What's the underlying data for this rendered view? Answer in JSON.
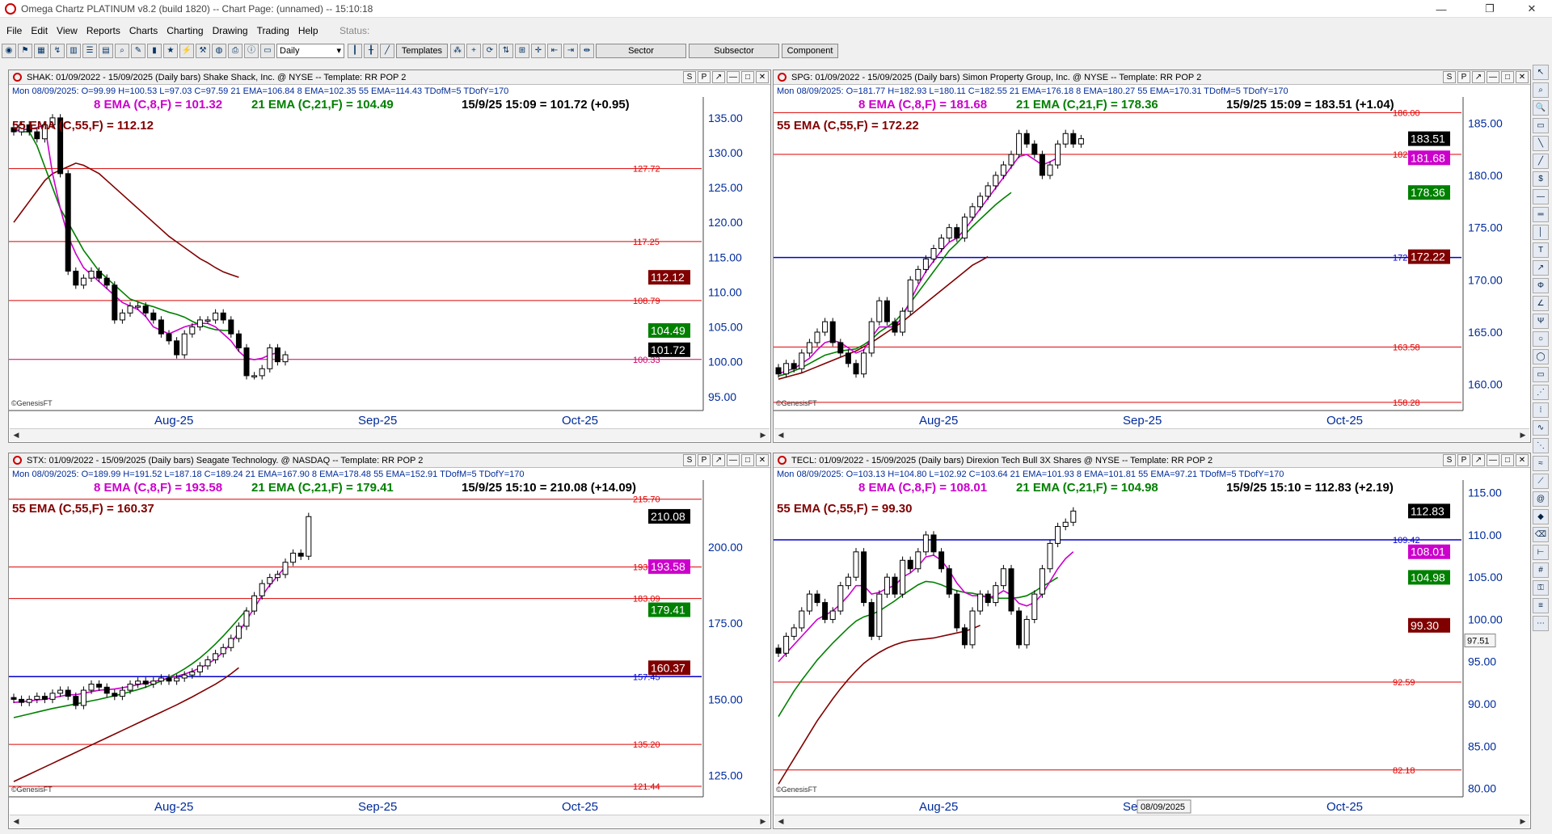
{
  "window": {
    "title": "Omega Chartz PLATINUM v8.2 (build 1820)  --  Chart Page: (unnamed)  --  15:10:18",
    "controls": [
      "—",
      "❐",
      "✕"
    ]
  },
  "menu": {
    "items": [
      "File",
      "Edit",
      "View",
      "Reports",
      "Charts",
      "Charting",
      "Drawing",
      "Trading",
      "Help"
    ],
    "status": "Status:"
  },
  "toolbar": {
    "period": "Daily",
    "templates_label": "Templates",
    "sector_label": "Sector",
    "subsector_label": "Subsector",
    "component_label": "Component"
  },
  "colors": {
    "ema8": "#cc00cc",
    "ema21": "#008000",
    "ema55": "#800000",
    "red_line": "#dd0000",
    "blue_line": "#0000cc",
    "pink_line": "#cc0066",
    "info_text": "#002b9a"
  },
  "common": {
    "watermark": "©GenesisFT",
    "months": [
      "Aug-25",
      "Sep-25",
      "Oct-25"
    ],
    "panel_buttons": [
      "S",
      "P",
      "↗",
      "—",
      "□",
      "✕"
    ]
  },
  "panels": [
    {
      "header": "SHAK:  01/09/2022 - 15/09/2025  (Daily bars)   Shake Shack, Inc. @ NYSE  --  Template: RR POP 2",
      "info": "Mon   08/09/2025:   O=99.99   H=100.53   L=97.03   C=97.59   21 EMA=106.84   8 EMA=102.35   55 EMA=114.43   TDofM=5   TDofY=170",
      "legend_ema8": "8 EMA (C,8,F) = 101.32",
      "legend_ema21": "21 EMA (C,21,F) = 104.49",
      "legend_last": "15/9/25 15:09 = 101.72 (+0.95)",
      "legend_ema55": "55 EMA (C,55,F) = 112.12",
      "ymin": 93,
      "ymax": 138,
      "yticks": [
        95,
        100,
        105,
        110,
        115,
        120,
        125,
        130,
        135
      ],
      "hlines": [
        {
          "v": 127.72,
          "label": "127.72",
          "c": "red"
        },
        {
          "v": 117.25,
          "label": "117.25",
          "c": "red"
        },
        {
          "v": 108.79,
          "label": "108.79",
          "c": "red"
        },
        {
          "v": 100.33,
          "label": "100.33",
          "c": "pink"
        }
      ],
      "tags": [
        {
          "v": 112.12,
          "label": "112.12",
          "bg": "#800000"
        },
        {
          "v": 104.49,
          "label": "104.49",
          "bg": "#008000"
        },
        {
          "v": 101.72,
          "label": "101.72",
          "bg": "#000000"
        }
      ],
      "closes": [
        133,
        134,
        133,
        132,
        134,
        135,
        127,
        113,
        111,
        112,
        113,
        112,
        111,
        106,
        107,
        108,
        108,
        107,
        106,
        104,
        103,
        101,
        104,
        105,
        106,
        106,
        107,
        106,
        104,
        102,
        98,
        98,
        99,
        102,
        100,
        101
      ],
      "ema8": [
        133,
        133.3,
        133.4,
        133.6,
        134,
        127,
        122,
        118,
        115.5,
        113.5,
        112.5,
        111.5,
        110.5,
        109.5,
        108.5,
        108,
        107.5,
        106.5,
        105,
        104.5,
        104,
        104.5,
        105,
        105.3,
        105.5,
        105.5,
        105,
        104,
        103,
        101.5,
        100.5,
        100.3,
        100.5,
        101,
        101.3
      ],
      "ema21": [
        133.5,
        133,
        133,
        131,
        128,
        125,
        122,
        120,
        118,
        116,
        114.5,
        113,
        112,
        111,
        110,
        109,
        108.6,
        108.2,
        107.9,
        107.5,
        107.1,
        106.8,
        106.4,
        105.8,
        105.3,
        104.9,
        104.6,
        104.5,
        104.49
      ],
      "ema55": [
        120,
        121.5,
        123,
        124.5,
        126,
        127,
        127.5,
        128,
        128.5,
        128.2,
        127.6,
        127,
        126,
        125,
        124,
        123,
        122,
        121,
        120,
        119,
        118,
        117.2,
        116.4,
        115.6,
        114.8,
        114.2,
        113.5,
        112.9,
        112.5,
        112.12
      ]
    },
    {
      "header": "SPG:  01/09/2022 - 15/09/2025  (Daily bars)   Simon Property Group, Inc. @ NYSE  --  Template: RR POP 2",
      "info": "Mon   08/09/2025:   O=181.77   H=182.93   L=180.11   C=182.55   21 EMA=176.18   8 EMA=180.27   55 EMA=170.31   TDofM=5   TDofY=170",
      "legend_ema8": "8 EMA (C,8,F) = 181.68",
      "legend_ema21": "21 EMA (C,21,F) = 178.36",
      "legend_last": "15/9/25 15:09 = 183.51 (+1.04)",
      "legend_ema55": "55 EMA (C,55,F) = 172.22",
      "ymin": 157.5,
      "ymax": 187.5,
      "yticks": [
        160,
        165,
        170,
        175,
        180,
        185
      ],
      "hlines": [
        {
          "v": 186.0,
          "label": "186.00",
          "c": "red"
        },
        {
          "v": 182.01,
          "label": "182.01",
          "c": "red"
        },
        {
          "v": 172.14,
          "label": "172.14",
          "c": "blue"
        },
        {
          "v": 163.58,
          "label": "163.58",
          "c": "red"
        },
        {
          "v": 158.28,
          "label": "158.28",
          "c": "red"
        }
      ],
      "tags": [
        {
          "v": 183.51,
          "label": "183.51",
          "bg": "#000000"
        },
        {
          "v": 181.68,
          "label": "181.68",
          "bg": "#cc00cc"
        },
        {
          "v": 178.36,
          "label": "178.36",
          "bg": "#008000"
        },
        {
          "v": 172.22,
          "label": "172.22",
          "bg": "#800000"
        }
      ],
      "closes": [
        161,
        162,
        161.5,
        163,
        164,
        165,
        166,
        164,
        163,
        162,
        161,
        163,
        166,
        168,
        166,
        165,
        167,
        170,
        171,
        172,
        173,
        174,
        175,
        174,
        176,
        177,
        178,
        179,
        180,
        181,
        182,
        184,
        183,
        182,
        180,
        181,
        183,
        184,
        183,
        183.51
      ],
      "ema8": [
        161,
        161.3,
        161.5,
        162,
        162.5,
        163.3,
        164,
        164.2,
        164,
        163.5,
        163,
        163.3,
        164.5,
        165.5,
        165.5,
        165.5,
        166.5,
        168,
        169.5,
        170.8,
        171.8,
        172.8,
        173.6,
        174,
        174.8,
        175.8,
        176.8,
        177.8,
        178.8,
        179.8,
        180.8,
        181.8,
        182,
        181.5,
        181,
        181.3,
        181.68
      ],
      "ema21": [
        160.8,
        161,
        161.3,
        161.6,
        162,
        162.4,
        162.8,
        163,
        163.2,
        163.3,
        163.4,
        163.8,
        164.3,
        165,
        165.5,
        166,
        166.8,
        167.8,
        168.8,
        169.8,
        170.8,
        171.8,
        172.8,
        173.5,
        174.3,
        175.1,
        175.8,
        176.5,
        177.2,
        177.8,
        178.36
      ],
      "ema55": [
        160.5,
        160.7,
        160.9,
        161.1,
        161.4,
        161.7,
        162,
        162.3,
        162.6,
        162.9,
        163.2,
        163.6,
        164,
        164.5,
        165,
        165.5,
        166,
        166.6,
        167.2,
        167.8,
        168.4,
        169,
        169.6,
        170.2,
        170.8,
        171.4,
        171.8,
        172.22
      ]
    },
    {
      "header": "STX:  01/09/2022 - 15/09/2025  (Daily bars)   Seagate Technology. @ NASDAQ  --  Template: RR POP 2",
      "info": "Mon   08/09/2025:   O=189.99   H=191.52   L=187.18   C=189.24   21 EMA=167.90   8 EMA=178.48   55 EMA=152.91   TDofM=5   TDofY=170",
      "legend_ema8": "8 EMA (C,8,F) = 193.58",
      "legend_ema21": "21 EMA (C,21,F) = 179.41",
      "legend_last": "15/9/25 15:10 = 210.08 (+14.09)",
      "legend_ema55": "55 EMA (C,55,F) = 160.37",
      "ymin": 118,
      "ymax": 222,
      "yticks": [
        125,
        150,
        175,
        200
      ],
      "hlines": [
        {
          "v": 215.7,
          "label": "215.70",
          "c": "red"
        },
        {
          "v": 193.46,
          "label": "193.46",
          "c": "red"
        },
        {
          "v": 183.09,
          "label": "183.09",
          "c": "red"
        },
        {
          "v": 157.45,
          "label": "157.45",
          "c": "blue"
        },
        {
          "v": 135.2,
          "label": "135.20",
          "c": "red"
        },
        {
          "v": 121.44,
          "label": "121.44",
          "c": "red"
        }
      ],
      "tags": [
        {
          "v": 210.08,
          "label": "210.08",
          "bg": "#000000"
        },
        {
          "v": 193.58,
          "label": "193.58",
          "bg": "#cc00cc"
        },
        {
          "v": 179.41,
          "label": "179.41",
          "bg": "#008000"
        },
        {
          "v": 160.37,
          "label": "160.37",
          "bg": "#800000"
        }
      ],
      "closes": [
        150,
        149,
        150,
        151,
        150,
        152,
        153,
        151,
        148,
        153,
        155,
        154,
        152,
        151,
        153,
        155,
        156,
        155,
        156,
        157,
        156,
        157,
        158,
        159,
        161,
        163,
        165,
        167,
        170,
        174,
        179,
        184,
        188,
        190,
        191,
        195,
        198,
        197,
        210
      ],
      "ema8": [
        149,
        149.2,
        149.5,
        149.8,
        150,
        150.5,
        151,
        151.5,
        151.5,
        152,
        152.5,
        153,
        153.2,
        153.4,
        153.8,
        154.3,
        154.8,
        155.3,
        155.8,
        156.4,
        157,
        157.6,
        158.3,
        159.2,
        160.3,
        161.6,
        163.3,
        165.5,
        168.5,
        172,
        176,
        180,
        184,
        187.5,
        190.5,
        193.58
      ],
      "ema21": [
        144,
        144.6,
        145.2,
        145.8,
        146.4,
        147,
        147.5,
        148,
        148.5,
        149,
        149.5,
        150,
        150.6,
        151.2,
        151.8,
        152.5,
        153.2,
        154,
        155,
        156,
        157.2,
        158.5,
        160,
        161.7,
        163.6,
        165.8,
        168.2,
        170.8,
        173.6,
        176.5,
        179.41
      ],
      "ema55": [
        123,
        124.2,
        125.4,
        126.6,
        127.8,
        129,
        130.2,
        131.4,
        132.6,
        133.8,
        135,
        136.2,
        137.4,
        138.6,
        139.8,
        141,
        142.2,
        143.4,
        144.6,
        145.8,
        147,
        148.2,
        149.5,
        150.8,
        152.2,
        153.6,
        155,
        156.6,
        158.4,
        160.37
      ]
    },
    {
      "header": "TECL:  01/09/2022 - 15/09/2025  (Daily bars)   Direxion Tech Bull 3X Shares @ NYSE  --  Template: RR POP 2",
      "info": "Mon   08/09/2025:   O=103.13   H=104.80   L=102.92   C=103.64   21 EMA=101.93   8 EMA=101.81   55 EMA=97.21   TDofM=5   TDofY=170",
      "legend_ema8": "8 EMA (C,8,F) = 108.01",
      "legend_ema21": "21 EMA (C,21,F) = 104.98",
      "legend_last": "15/9/25 15:10 = 112.83 (+2.19)",
      "legend_ema55": "55 EMA (C,55,F) = 99.30",
      "ymin": 79,
      "ymax": 116.5,
      "yticks": [
        80,
        85,
        90,
        95,
        100,
        105,
        110,
        115
      ],
      "hlines": [
        {
          "v": 109.42,
          "label": "109.42",
          "c": "blue"
        },
        {
          "v": 92.59,
          "label": "92.59",
          "c": "red"
        },
        {
          "v": 82.18,
          "label": "82.18",
          "c": "red"
        }
      ],
      "tags": [
        {
          "v": 112.83,
          "label": "112.83",
          "bg": "#000000"
        },
        {
          "v": 108.01,
          "label": "108.01",
          "bg": "#cc00cc"
        },
        {
          "v": 104.98,
          "label": "104.98",
          "bg": "#008000"
        },
        {
          "v": 99.3,
          "label": "99.30",
          "bg": "#800000"
        }
      ],
      "closes": [
        96,
        98,
        99,
        101,
        103,
        102,
        100,
        101,
        104,
        105,
        108,
        102,
        98,
        103,
        105,
        103,
        107,
        106,
        108,
        110,
        108,
        106,
        103,
        99,
        97,
        101,
        103,
        102,
        104,
        106,
        101,
        97,
        100,
        103,
        106,
        109,
        111,
        111.5,
        112.83
      ],
      "ema8": [
        95,
        96,
        97,
        98,
        99,
        100,
        100.5,
        101,
        101.8,
        102.8,
        104,
        104,
        103,
        103.2,
        103.7,
        104,
        105,
        105.5,
        106.3,
        107.4,
        107.6,
        107,
        105.8,
        104.3,
        103.2,
        102.8,
        102.8,
        102.6,
        102.8,
        103.4,
        102.9,
        101.9,
        101.6,
        102,
        103,
        104.5,
        106,
        107.2,
        108.01
      ],
      "ema21": [
        88.5,
        90,
        91.5,
        92.8,
        94,
        95.2,
        96.2,
        97.2,
        98.1,
        99,
        99.8,
        100.3,
        100.6,
        101,
        101.6,
        102.2,
        102.9,
        103.5,
        104.1,
        104.5,
        104.4,
        104.1,
        103.7,
        103.4,
        103.2,
        103.1,
        102.9,
        102.6,
        102.5,
        102.5,
        102.5,
        102.6,
        102.8,
        103.3,
        103.9,
        104.4,
        104.98
      ],
      "ema55": [
        80.5,
        82,
        83.5,
        85,
        86.5,
        88,
        89.3,
        90.6,
        91.8,
        92.9,
        93.9,
        94.8,
        95.5,
        96.1,
        96.6,
        97,
        97.3,
        97.5,
        97.6,
        97.7,
        97.8,
        98,
        98.2,
        98.4,
        98.6,
        98.9,
        99.3
      ]
    }
  ],
  "crosshair": {
    "value": "97.51",
    "date": "08/09/2025"
  }
}
